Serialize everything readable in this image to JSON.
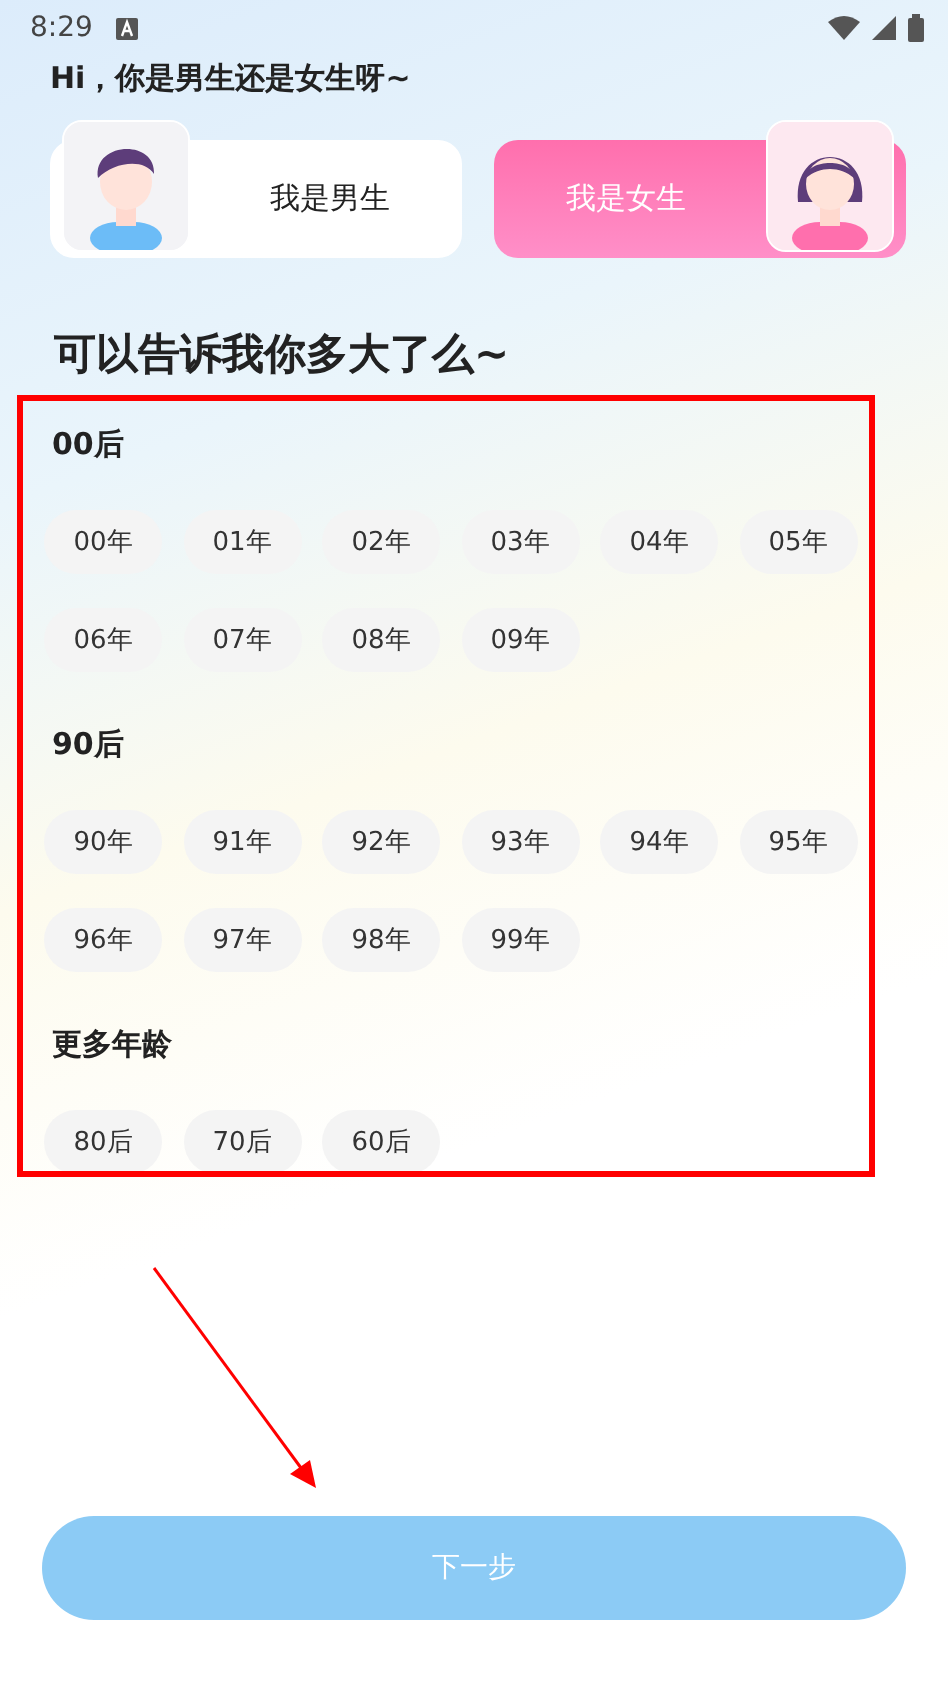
{
  "status_bar": {
    "time": "8:29"
  },
  "greeting": "Hi，你是男生还是女生呀~",
  "genders": [
    {
      "kind": "male",
      "label": "我是男生",
      "selected": false
    },
    {
      "kind": "female",
      "label": "我是女生",
      "selected": true
    }
  ],
  "age_question": "可以告诉我你多大了么~",
  "age_groups": [
    {
      "title": "00后",
      "options": [
        {
          "label": "00年",
          "selected": false
        },
        {
          "label": "01年",
          "selected": false
        },
        {
          "label": "02年",
          "selected": false
        },
        {
          "label": "03年",
          "selected": false
        },
        {
          "label": "04年",
          "selected": false
        },
        {
          "label": "05年",
          "selected": false
        },
        {
          "label": "06年",
          "selected": false
        },
        {
          "label": "07年",
          "selected": false
        },
        {
          "label": "08年",
          "selected": false
        },
        {
          "label": "09年",
          "selected": false
        }
      ]
    },
    {
      "title": "90后",
      "options": [
        {
          "label": "90年",
          "selected": false
        },
        {
          "label": "91年",
          "selected": false
        },
        {
          "label": "92年",
          "selected": false
        },
        {
          "label": "93年",
          "selected": false
        },
        {
          "label": "94年",
          "selected": false
        },
        {
          "label": "95年",
          "selected": false
        },
        {
          "label": "96年",
          "selected": false
        },
        {
          "label": "97年",
          "selected": false
        },
        {
          "label": "98年",
          "selected": false
        },
        {
          "label": "99年",
          "selected": false
        }
      ]
    },
    {
      "title": "更多年龄",
      "options": [
        {
          "label": "80后",
          "selected": false
        },
        {
          "label": "70后",
          "selected": false
        },
        {
          "label": "60后",
          "selected": false
        }
      ]
    }
  ],
  "next_button": {
    "label": "下一步",
    "disabled": true
  }
}
